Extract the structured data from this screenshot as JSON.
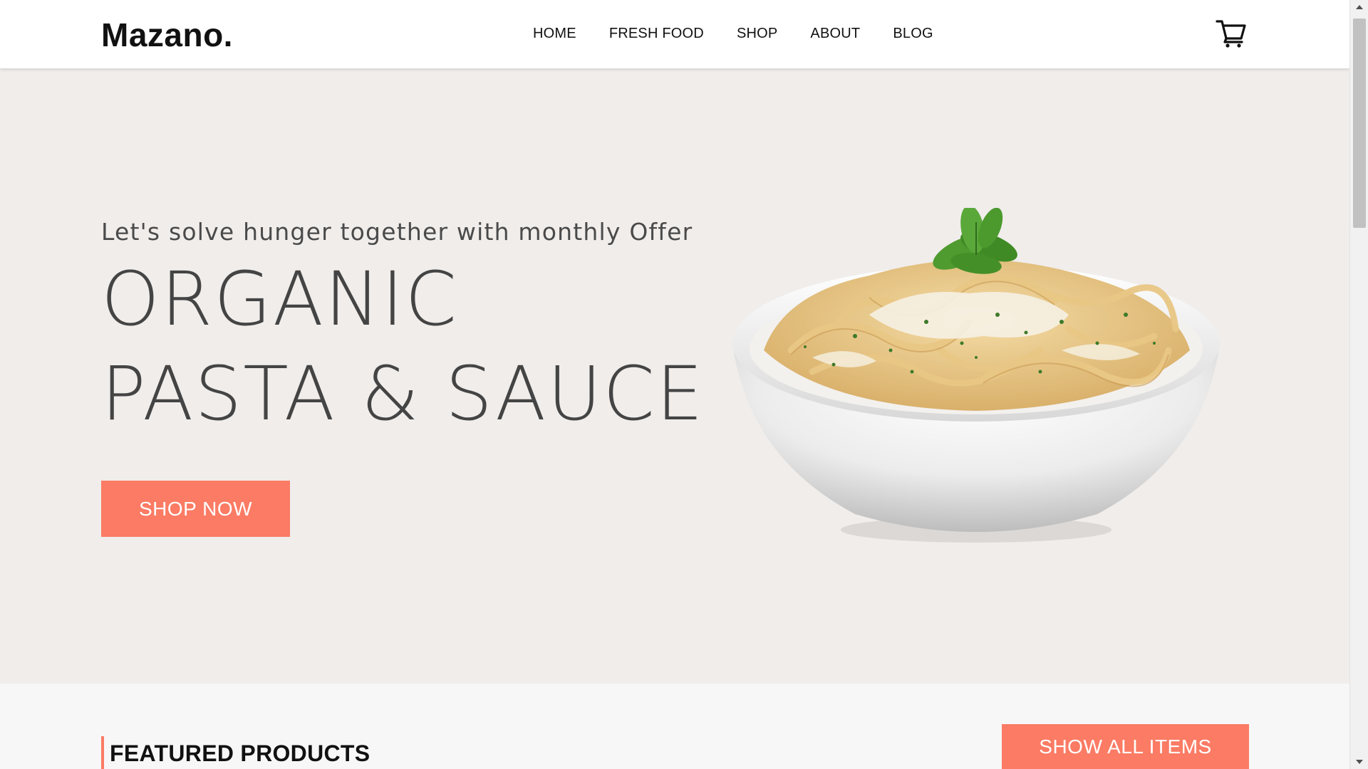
{
  "brand": {
    "logo": "Mazano."
  },
  "nav": {
    "items": [
      {
        "label": "HOME"
      },
      {
        "label": "FRESH FOOD"
      },
      {
        "label": "SHOP"
      },
      {
        "label": "ABOUT"
      },
      {
        "label": "BLOG"
      }
    ],
    "cart_icon": "shopping-cart-icon"
  },
  "hero": {
    "subtitle": "Let's solve hunger together with monthly Offer",
    "title_line1": "ORGANIC",
    "title_line2": "PASTA & SAUCE",
    "cta_label": "SHOP NOW",
    "image": "pasta-bowl-image"
  },
  "featured": {
    "heading": "FEATURED PRODUCTS",
    "show_all_label": "SHOW ALL ITEMS"
  },
  "colors": {
    "accent": "#fb7b64",
    "hero_bg": "#f0edeb",
    "text_dark": "#111111",
    "text_hero": "#444444"
  }
}
